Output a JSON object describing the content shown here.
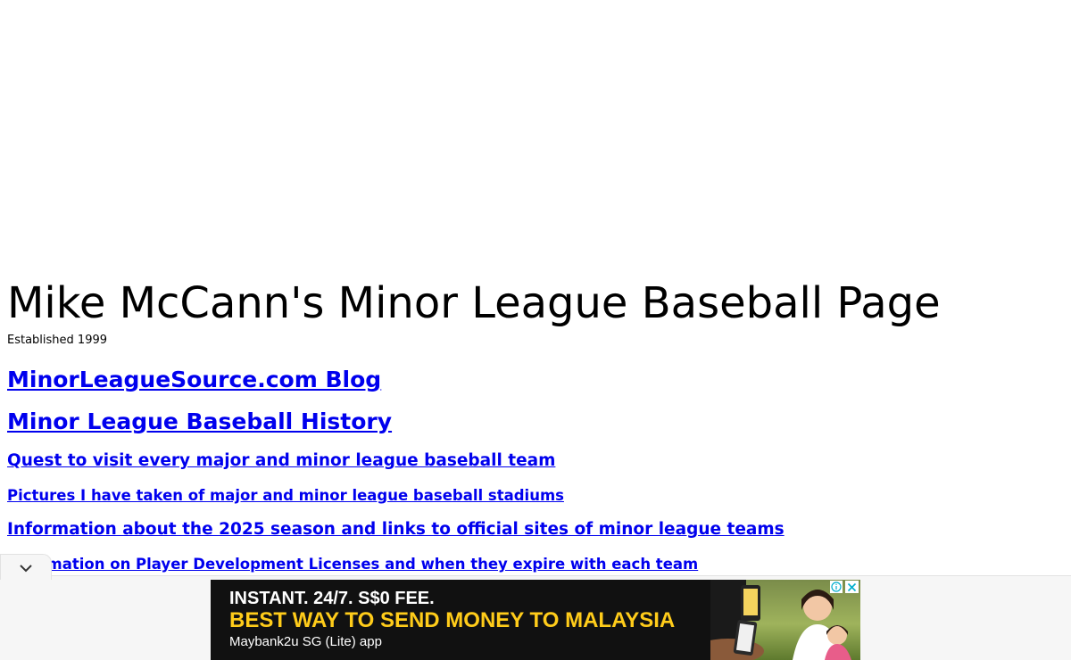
{
  "page": {
    "title": "Mike McCann's Minor League Baseball Page",
    "subtitle": "Established 1999"
  },
  "links": [
    {
      "label": "MinorLeagueSource.com Blog"
    },
    {
      "label": "Minor League Baseball History"
    },
    {
      "label": "Quest to visit every major and minor league baseball team"
    },
    {
      "label": "Pictures I have taken of major and minor league baseball stadiums"
    },
    {
      "label": "Information about the 2025 season and links to official sites of minor league teams"
    },
    {
      "label": "Information on Player Development Licenses and when they expire with each team"
    }
  ],
  "ad": {
    "line1": "INSTANT. 24/7. S$0 FEE.",
    "line2": "BEST WAY TO SEND MONEY TO MALAYSIA",
    "line3": "Maybank2u SG (Lite) app",
    "colors": {
      "background": "#111111",
      "headline": "#ffcc1a",
      "text": "#ffffff",
      "info_icon": "#00aecd"
    },
    "icons": {
      "info": "info-icon",
      "close": "close-icon",
      "collapse": "chevron-down-icon"
    }
  }
}
